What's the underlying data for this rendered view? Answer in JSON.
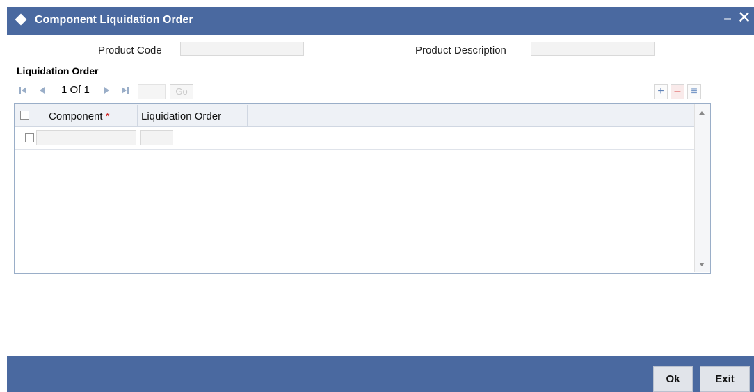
{
  "window": {
    "title": "Component Liquidation Order",
    "minimize_glyph": "–",
    "close_glyph": "✕"
  },
  "header": {
    "product_code_label": "Product Code",
    "product_code_value": "",
    "product_description_label": "Product Description",
    "product_description_value": ""
  },
  "section": {
    "title": "Liquidation Order"
  },
  "pager": {
    "page_text": "1 Of 1",
    "page_input_value": "",
    "go_label": "Go",
    "icons": [
      "first-page-icon",
      "previous-page-icon",
      "next-page-icon",
      "last-page-icon"
    ]
  },
  "toolbar": {
    "add_icon": "+",
    "delete_icon": "–",
    "single_view_icon": "≡"
  },
  "grid": {
    "columns": [
      {
        "label": "Component",
        "required": true,
        "required_mark": "*"
      },
      {
        "label": "Liquidation Order",
        "required": false
      }
    ],
    "rows": [
      {
        "component": "",
        "liquidation_order": ""
      }
    ]
  },
  "footer": {
    "ok_label": "Ok",
    "exit_label": "Exit"
  },
  "colors": {
    "title_bar": "#4a69a0",
    "required": "#cc1b1b",
    "grid_border": "#9aaec8"
  }
}
